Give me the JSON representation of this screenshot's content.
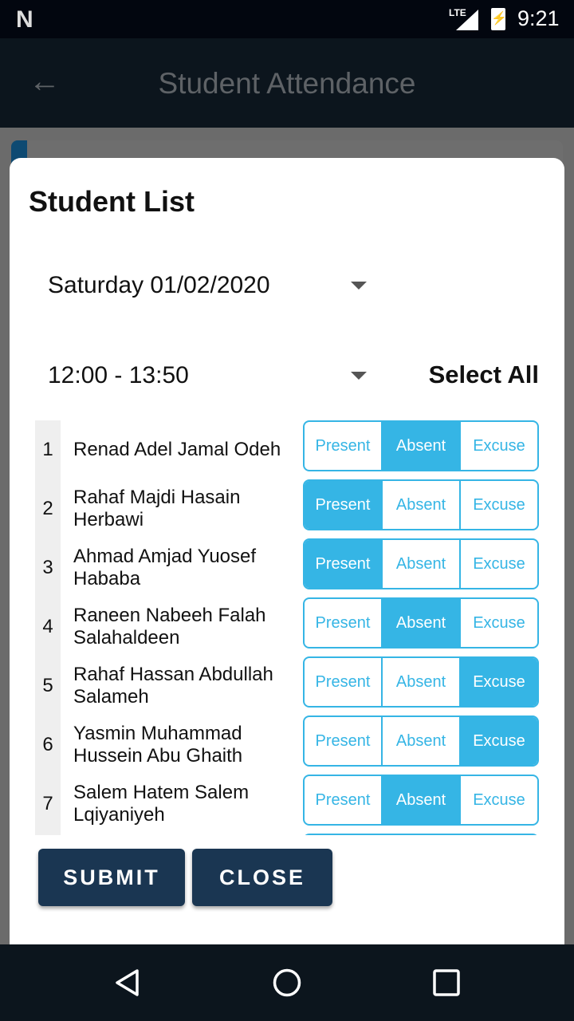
{
  "status_bar": {
    "time": "9:21",
    "network": "LTE"
  },
  "app_bar": {
    "title": "Student Attendance"
  },
  "dialog": {
    "title": "Student List",
    "date_select": "Saturday 01/02/2020",
    "time_select": "12:00 - 13:50",
    "select_all": "Select All",
    "options": [
      "Present",
      "Absent",
      "Excuse"
    ],
    "students": [
      {
        "num": "1",
        "name": "Renad Adel Jamal Odeh",
        "status": "Absent"
      },
      {
        "num": "2",
        "name": "Rahaf Majdi Hasain Herbawi",
        "status": "Present"
      },
      {
        "num": "3",
        "name": "Ahmad Amjad Yuosef Hababa",
        "status": "Present"
      },
      {
        "num": "4",
        "name": "Raneen Nabeeh Falah Salahaldeen",
        "status": "Absent"
      },
      {
        "num": "5",
        "name": "Rahaf Hassan Abdullah Salameh",
        "status": "Excuse"
      },
      {
        "num": "6",
        "name": "Yasmin Muhammad Hussein Abu Ghaith",
        "status": "Excuse"
      },
      {
        "num": "7",
        "name": "Salem Hatem Salem Lqiyaniyeh",
        "status": "Absent"
      },
      {
        "num": "",
        "name": "",
        "status": "Absent"
      }
    ],
    "submit": "SUBMIT",
    "close": "CLOSE"
  },
  "colors": {
    "accent": "#35b5e5",
    "button": "#1a3652",
    "app_bar": "#0c151d"
  }
}
